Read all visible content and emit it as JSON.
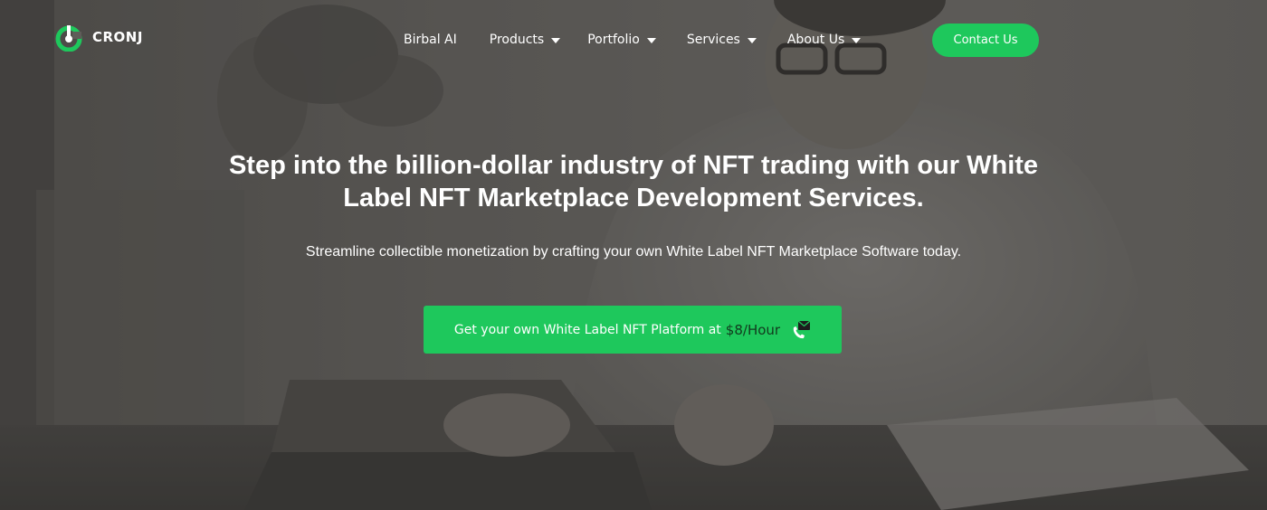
{
  "brand": {
    "name": "CRONJ",
    "accent_color": "#1ec85c"
  },
  "nav": {
    "items": [
      {
        "label": "Birbal AI",
        "has_dropdown": false
      },
      {
        "label": "Products",
        "has_dropdown": true
      },
      {
        "label": "Portfolio",
        "has_dropdown": true
      },
      {
        "label": "Services",
        "has_dropdown": true
      },
      {
        "label": "About Us",
        "has_dropdown": true
      }
    ],
    "contact_label": "Contact Us"
  },
  "hero": {
    "headline_line1": "Step into the billion-dollar industry of NFT trading with our White",
    "headline_line2": "Label NFT Marketplace Development Services.",
    "subheadline": "Streamline collectible monetization by crafting your own White Label NFT Marketplace Software today.",
    "cta_text": "Get your own White Label NFT Platform at",
    "cta_price": "$8/Hour",
    "cta_icon": "phone-message-icon"
  }
}
